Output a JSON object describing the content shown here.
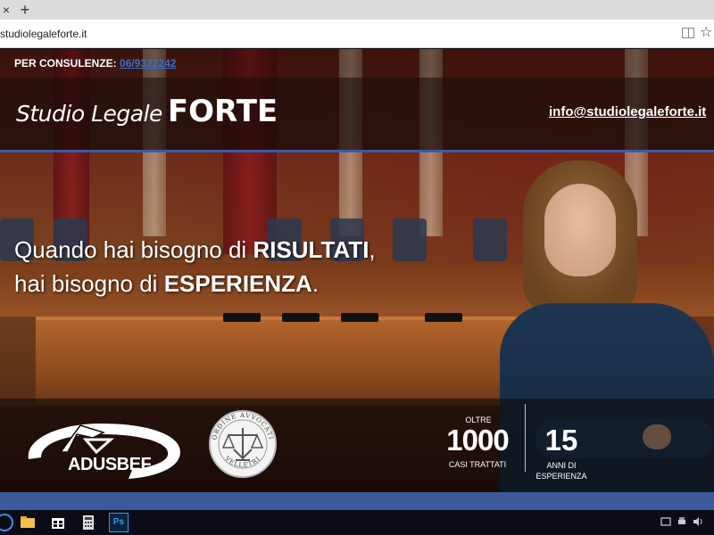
{
  "browser": {
    "tab_close": "×",
    "new_tab": "+",
    "url": "studiolegaleforte.it",
    "star": "☆"
  },
  "site": {
    "consult_label": "PER CONSULENZE:",
    "phone": "06/9322242",
    "brand_light": "Studio Legale",
    "brand_bold": "FORTE",
    "email": "info@studiolegaleforte.it",
    "headline": {
      "line1_pre": "Quando hai bisogno di ",
      "line1_bold": "RISULTATI",
      "line1_post": ",",
      "line2_pre": "hai bisogno di ",
      "line2_bold": "ESPERIENZA",
      "line2_post": "."
    },
    "logos": {
      "adusbef": "ADUSBEF",
      "ordine_top": "ORDINE AVVOCATI",
      "ordine_bottom": "VELLETRI"
    },
    "stats": {
      "oltre": "OLTRE",
      "cases": "1000",
      "cases_label": "CASI TRATTATI",
      "years": "15",
      "years_label_1": "ANNI DI",
      "years_label_2": "ESPERIENZA"
    }
  },
  "taskbar": {
    "photoshop_label": "Ps",
    "items": [
      "start-icon",
      "file-explorer-icon",
      "store-icon",
      "calculator-icon",
      "photoshop-icon"
    ],
    "tray": [
      "tray-window-icon",
      "tray-printer-icon",
      "tray-volume-icon"
    ]
  },
  "colors": {
    "accent_blue": "#3b5a9a",
    "phone_link": "#3a6ec6",
    "taskbar": "#0c0c16"
  }
}
